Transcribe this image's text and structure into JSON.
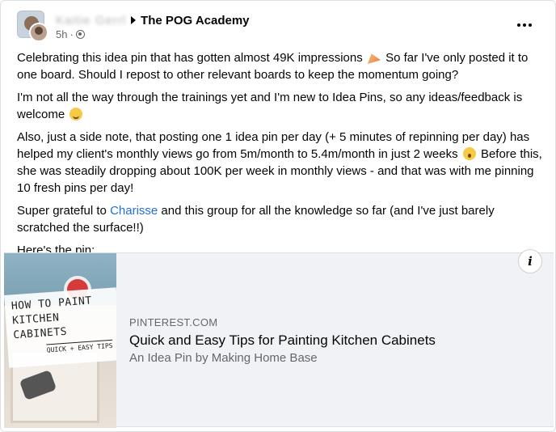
{
  "post": {
    "author_name": "Kaitie Gerrl",
    "group_name": "The POG Academy",
    "time": "5h",
    "time_separator": "·",
    "paragraphs": {
      "p1_a": "Celebrating this idea pin that has gotten almost 49K impressions",
      "p1_b": " So far I've only posted it to one board. Should I repost to other relevant boards to keep the momentum going?",
      "p2": "I'm not all the way through the trainings yet and I'm new to Idea Pins, so any ideas/feedback is welcome",
      "p3_a": "Also, just a side note, that posting one 1 idea pin per day (+ 5 minutes of repinning per day) has helped my client's monthly views go from 5m/month to 5.4m/month in just 2 weeks",
      "p3_b": " Before this, she was steadily dropping about 100K per week in monthly views - and that was with me pinning 10 fresh pins per day!",
      "p4_a": "Super grateful to ",
      "p4_mention": "Charisse",
      "p4_b": " and this group for all the knowledge so far (and I've just barely scratched the surface!!)",
      "p5": "Here's the pin:"
    },
    "icons": [
      "globe-icon",
      "more-options-icon",
      "party-popper-icon",
      "smile-icon",
      "shocked-face-icon",
      "info-icon"
    ]
  },
  "link_preview": {
    "thumb_title_line1": "HOW TO PAINT",
    "thumb_title_line2": "KITCHEN CABINETS",
    "thumb_tag": "QUICK + EASY TIPS",
    "domain": "PINTEREST.COM",
    "title": "Quick and Easy Tips for Painting Kitchen Cabinets",
    "description": "An Idea Pin by Making Home Base",
    "info_label": "i"
  },
  "colors": {
    "mention": "#216fdb",
    "secondary_text": "#65676b",
    "preview_background": "#f0f2f5"
  }
}
